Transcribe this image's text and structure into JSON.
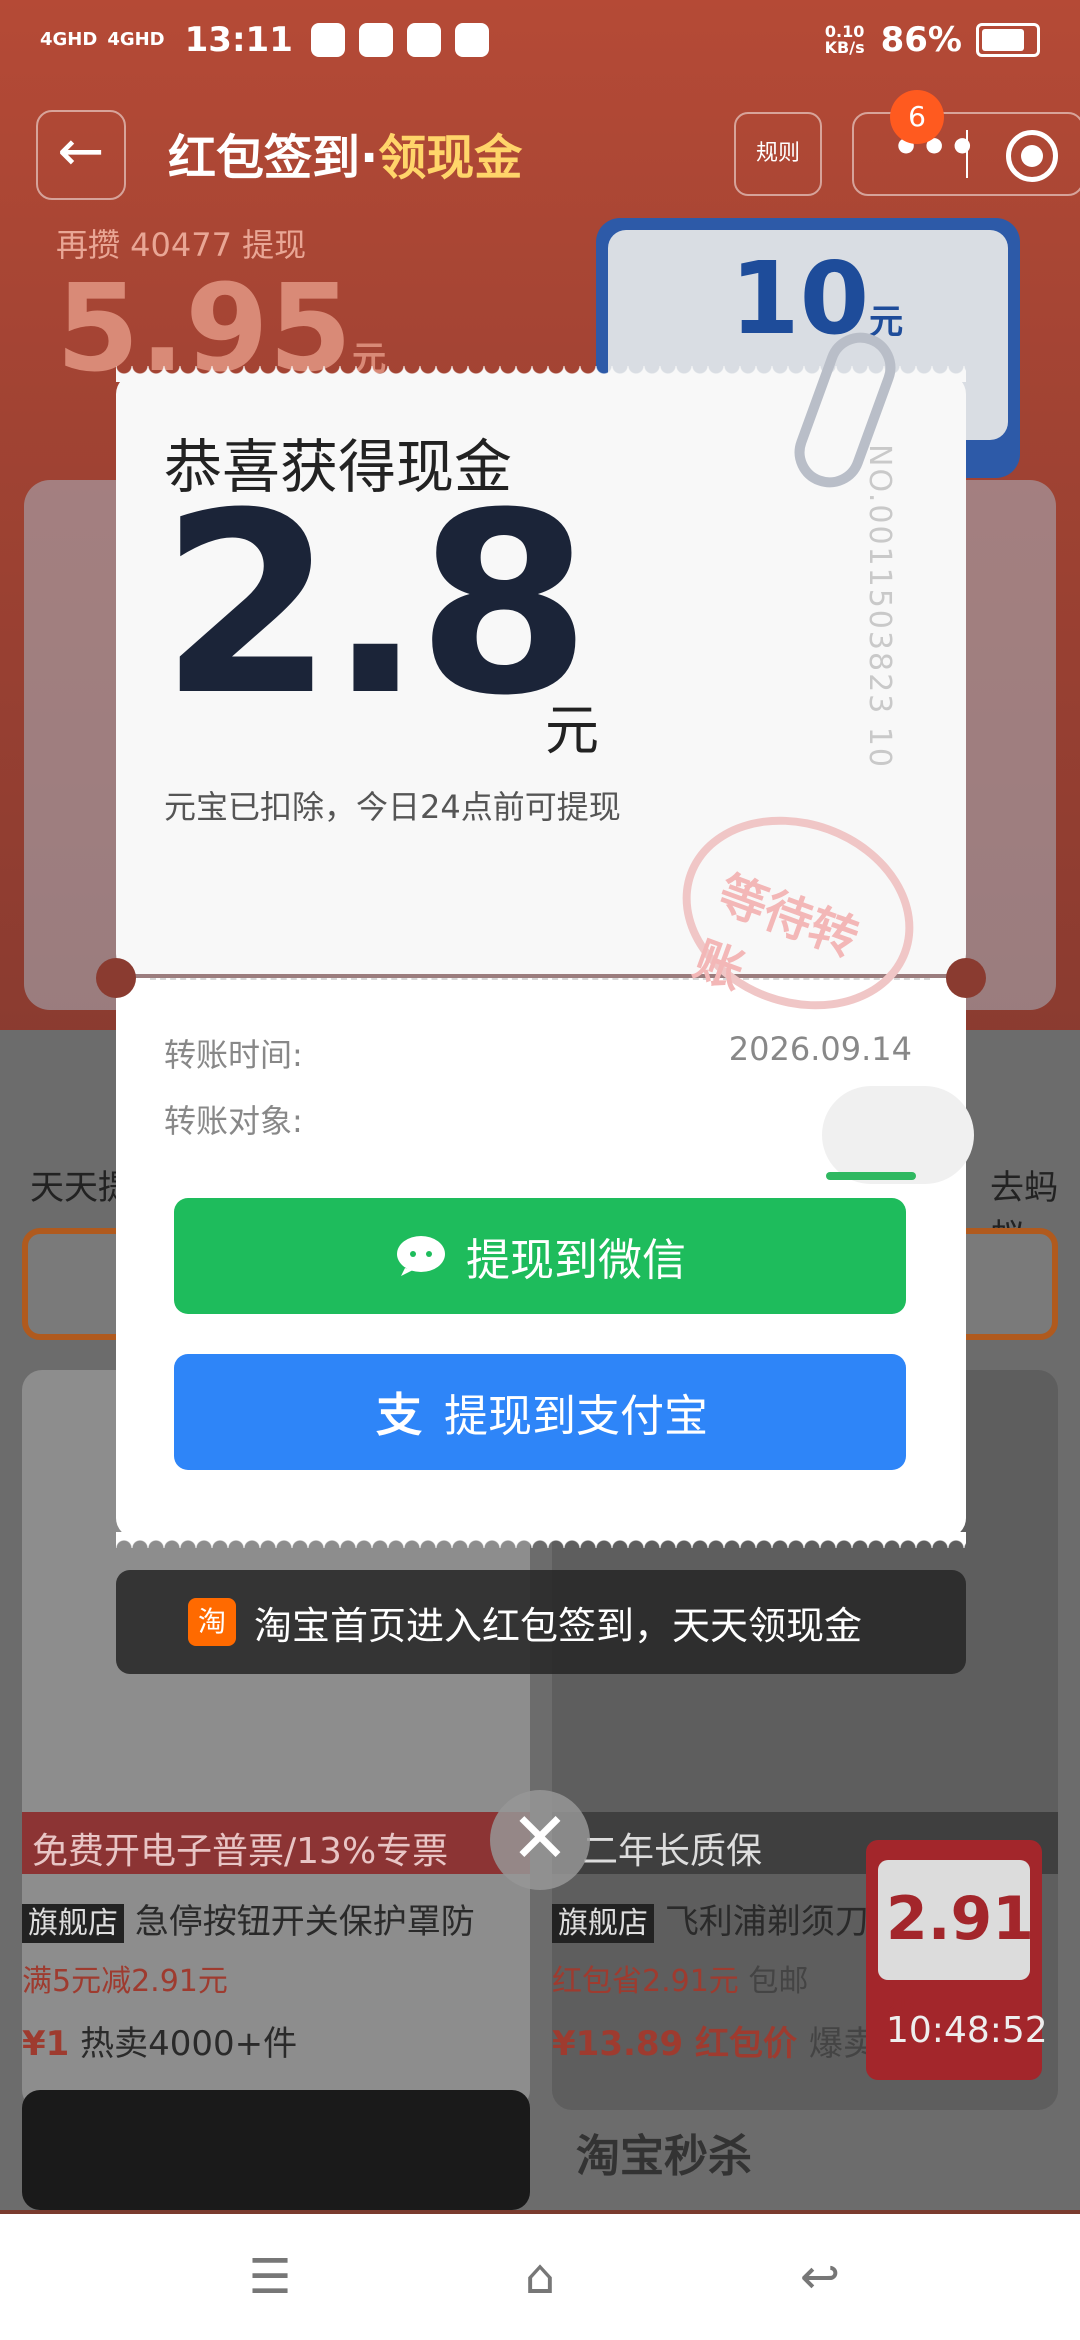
{
  "status_bar": {
    "signal1": "4GHD",
    "signal2": "4GHD",
    "time": "13:11",
    "speed_value": "0.10",
    "speed_unit": "KB/s",
    "battery": "86%"
  },
  "nav": {
    "title_part1": "红包签到·",
    "title_part2": "领现金",
    "rules_label": "规则",
    "badge_count": "6"
  },
  "background": {
    "earn_hint": "再攒 40477 提现",
    "balance": "5.95",
    "balance_unit": "元",
    "reward_card_value": "10",
    "reward_card_unit": "元",
    "product_left_title": "急停按钮开关保护罩防",
    "product_left_promo": "满5元减2.91元",
    "product_left_price": "¥1",
    "product_left_sales": "热卖4000+件",
    "product_right_title": "飞利浦剃须刀",
    "product_right_promo": "红包省2.91元",
    "product_right_shipping": "包邮",
    "product_right_price": "¥13.89",
    "product_right_price_label": "红包价",
    "product_right_hot": "爆卖",
    "store_tag": "旗舰店",
    "invoice_strip": "免费开电子普票/13%专票",
    "warranty_strip": "二年长质保",
    "price_tag_value": "2.91",
    "price_tag_unit": "元",
    "countdown": "10:48:52",
    "flash_sale": "淘宝秒杀",
    "tile_right_label": "去蚂蚁",
    "tile_left_label": "天天提"
  },
  "dialog": {
    "title": "恭喜获得现金",
    "amount": "2.8",
    "unit": "元",
    "note": "元宝已扣除，今日24点前可提现",
    "serial": "NO.0011503823 10",
    "stamp_text": "等待转账",
    "transfer_time_label": "转账时间:",
    "transfer_time_value": "2026.09.14",
    "transfer_target_label": "转账对象:",
    "wechat_button": "提现到微信",
    "alipay_button": "提现到支付宝"
  },
  "toast": {
    "icon_text": "淘",
    "text": "淘宝首页进入红包签到，天天领现金"
  },
  "close_symbol": "✕",
  "system_nav": {
    "menu": "☰",
    "home": "⌂",
    "back": "↩"
  }
}
